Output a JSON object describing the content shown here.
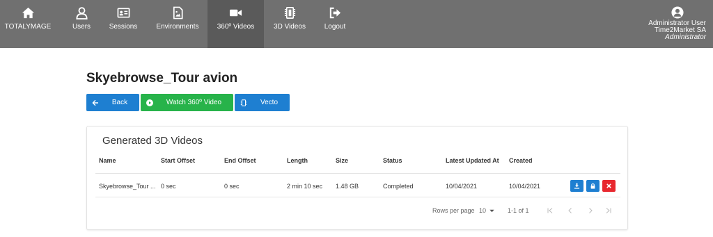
{
  "nav": {
    "items": [
      {
        "label": "TOTALYMAGE",
        "icon": "home-icon"
      },
      {
        "label": "Users",
        "icon": "user-icon"
      },
      {
        "label": "Sessions",
        "icon": "id-card-icon"
      },
      {
        "label": "Environments",
        "icon": "file-image-icon"
      },
      {
        "label": "360º Videos",
        "icon": "video-camera-icon",
        "active": true
      },
      {
        "label": "3D Videos",
        "icon": "chip-icon"
      },
      {
        "label": "Logout",
        "icon": "logout-icon"
      }
    ],
    "user": {
      "name": "Administrator User",
      "company": "Time2Market SA",
      "role": "Administrator"
    }
  },
  "page": {
    "title": "Skyebrowse_Tour avion"
  },
  "buttons": {
    "back": "Back",
    "watch": "Watch 360º Video",
    "vecto": "Vecto"
  },
  "card": {
    "title": "Generated 3D Videos",
    "columns": [
      "Name",
      "Start Offset",
      "End Offset",
      "Length",
      "Size",
      "Status",
      "Latest Updated At",
      "Created"
    ],
    "rows": [
      [
        "Skyebrowse_Tour ...",
        "0 sec",
        "0 sec",
        "2 min 10 sec",
        "1.48 GB",
        "Completed",
        "10/04/2021",
        "10/04/2021"
      ]
    ]
  },
  "pagination": {
    "rows_per_page_label": "Rows per page",
    "rows_per_page_value": "10",
    "range": "1-1 of 1"
  },
  "colors": {
    "nav_bg": "#707070",
    "nav_active": "#5a5a5a",
    "primary": "#1e7fd1",
    "success": "#27b34a",
    "danger": "#e8282f"
  }
}
